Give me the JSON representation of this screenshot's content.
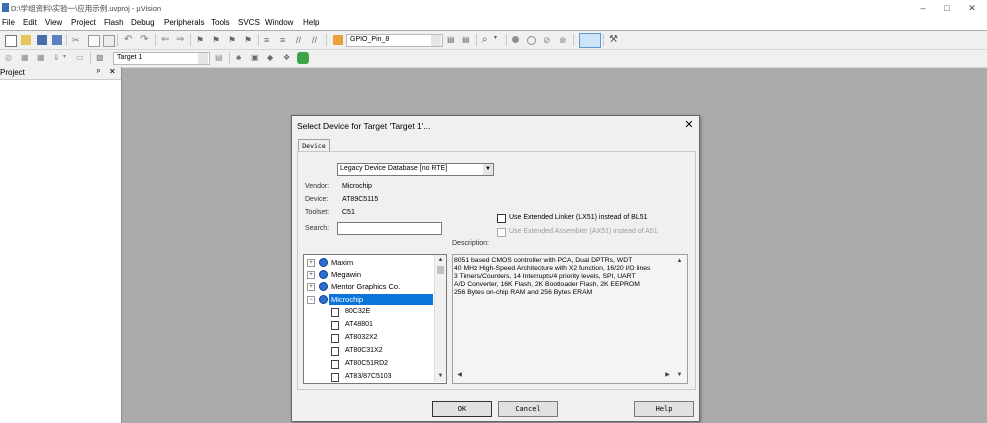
{
  "window": {
    "title": "D:\\学组资料\\实验一\\应用示例.uvproj - µVision",
    "minimize": "–",
    "maximize": "□",
    "close": "✕"
  },
  "menu": [
    "File",
    "Edit",
    "View",
    "Project",
    "Flash",
    "Debug",
    "Peripherals",
    "Tools",
    "SVCS",
    "Window",
    "Help"
  ],
  "toolbar1": {
    "combo_value": "GPIO_Pin_8"
  },
  "toolbar2": {
    "target_value": "Target 1"
  },
  "project_pane": {
    "title": "Project",
    "pin": "ᵖ",
    "close": "✕"
  },
  "dialog": {
    "title": "Select Device for Target 'Target 1'...",
    "close": "✕",
    "tab": "Device",
    "database_select": "Legacy Device Database [no RTE]",
    "vendor_label": "Vendor:",
    "vendor_value": "Microchip",
    "device_label": "Device:",
    "device_value": "AT89C5115",
    "toolset_label": "Toolset:",
    "toolset_value": "C51",
    "search_label": "Search:",
    "search_value": "",
    "opt_lx51": "Use Extended Linker (LX51) instead of BL51",
    "opt_ax51": "Use Extended Assembler (AX51) instead of A51",
    "description_label": "Description:",
    "description_lines": [
      "8051 based CMOS controller with PCA, Dual DPTRs, WDT",
      "40 MHz High-Speed Architecture with X2 function, 16/20 I/O lines",
      "3 Timers/Counters, 14 Interrupts/4 priority levels, SPI, UART",
      "A/D Converter, 16K Flash, 2K Bootloader Flash, 2K EEPROM",
      "256 Bytes on-chip RAM and 256 Bytes ERAM"
    ],
    "tree": {
      "vendors": [
        {
          "label": "Maxim",
          "toggle": "+"
        },
        {
          "label": "Megawin",
          "toggle": "+"
        },
        {
          "label": "Mentor Graphics Co.",
          "toggle": "+"
        },
        {
          "label": "Microchip",
          "toggle": "−",
          "selected": true
        }
      ],
      "devices": [
        "80C32E",
        "AT48801",
        "AT8032X2",
        "AT80C31X2",
        "AT80C51RD2",
        "AT83/87C5103"
      ]
    },
    "buttons": {
      "ok": "OK",
      "cancel": "Cancel",
      "help": "Help"
    }
  },
  "colors": {
    "selection": "#0a74da",
    "desktop": "#ababab",
    "dialog_bg": "#f0f0f0"
  }
}
